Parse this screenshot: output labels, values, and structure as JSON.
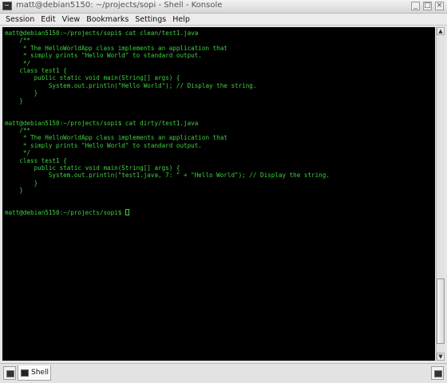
{
  "window": {
    "title": "matt@debian5150: ~/projects/sopi - Shell - Konsole",
    "minimize_label": "_",
    "maximize_label": "□",
    "close_label": "×"
  },
  "menu": {
    "items": [
      {
        "label": "Session"
      },
      {
        "label": "Edit"
      },
      {
        "label": "View"
      },
      {
        "label": "Bookmarks"
      },
      {
        "label": "Settings"
      },
      {
        "label": "Help"
      }
    ]
  },
  "terminal": {
    "text_color": "#3ed13e",
    "background": "#000000",
    "lines": [
      "matt@debian5150:~/projects/sopi$ cat clean/test1.java",
      "    /**",
      "     * The HelloWorldApp class implements an application that",
      "     * simply prints \"Hello World\" to standard output.",
      "     */",
      "    class test1 {",
      "        public static void main(String[] args) {",
      "            System.out.println(\"Hello World\"); // Display the string.",
      "        }",
      "    }",
      "",
      "",
      "matt@debian5150:~/projects/sopi$ cat dirty/test1.java",
      "    /**",
      "     * The HelloWorldApp class implements an application that",
      "     * simply prints \"Hello World\" to standard output.",
      "     */",
      "    class test1 {",
      "        public static void main(String[] args) {",
      "            System.out.println(\"test1.java, 7: \" + \"Hello World\"); // Display the string.",
      "        }",
      "    }",
      "",
      "",
      "matt@debian5150:~/projects/sopi$ "
    ]
  },
  "tabs": [
    {
      "label": "Shell",
      "active": true
    }
  ]
}
